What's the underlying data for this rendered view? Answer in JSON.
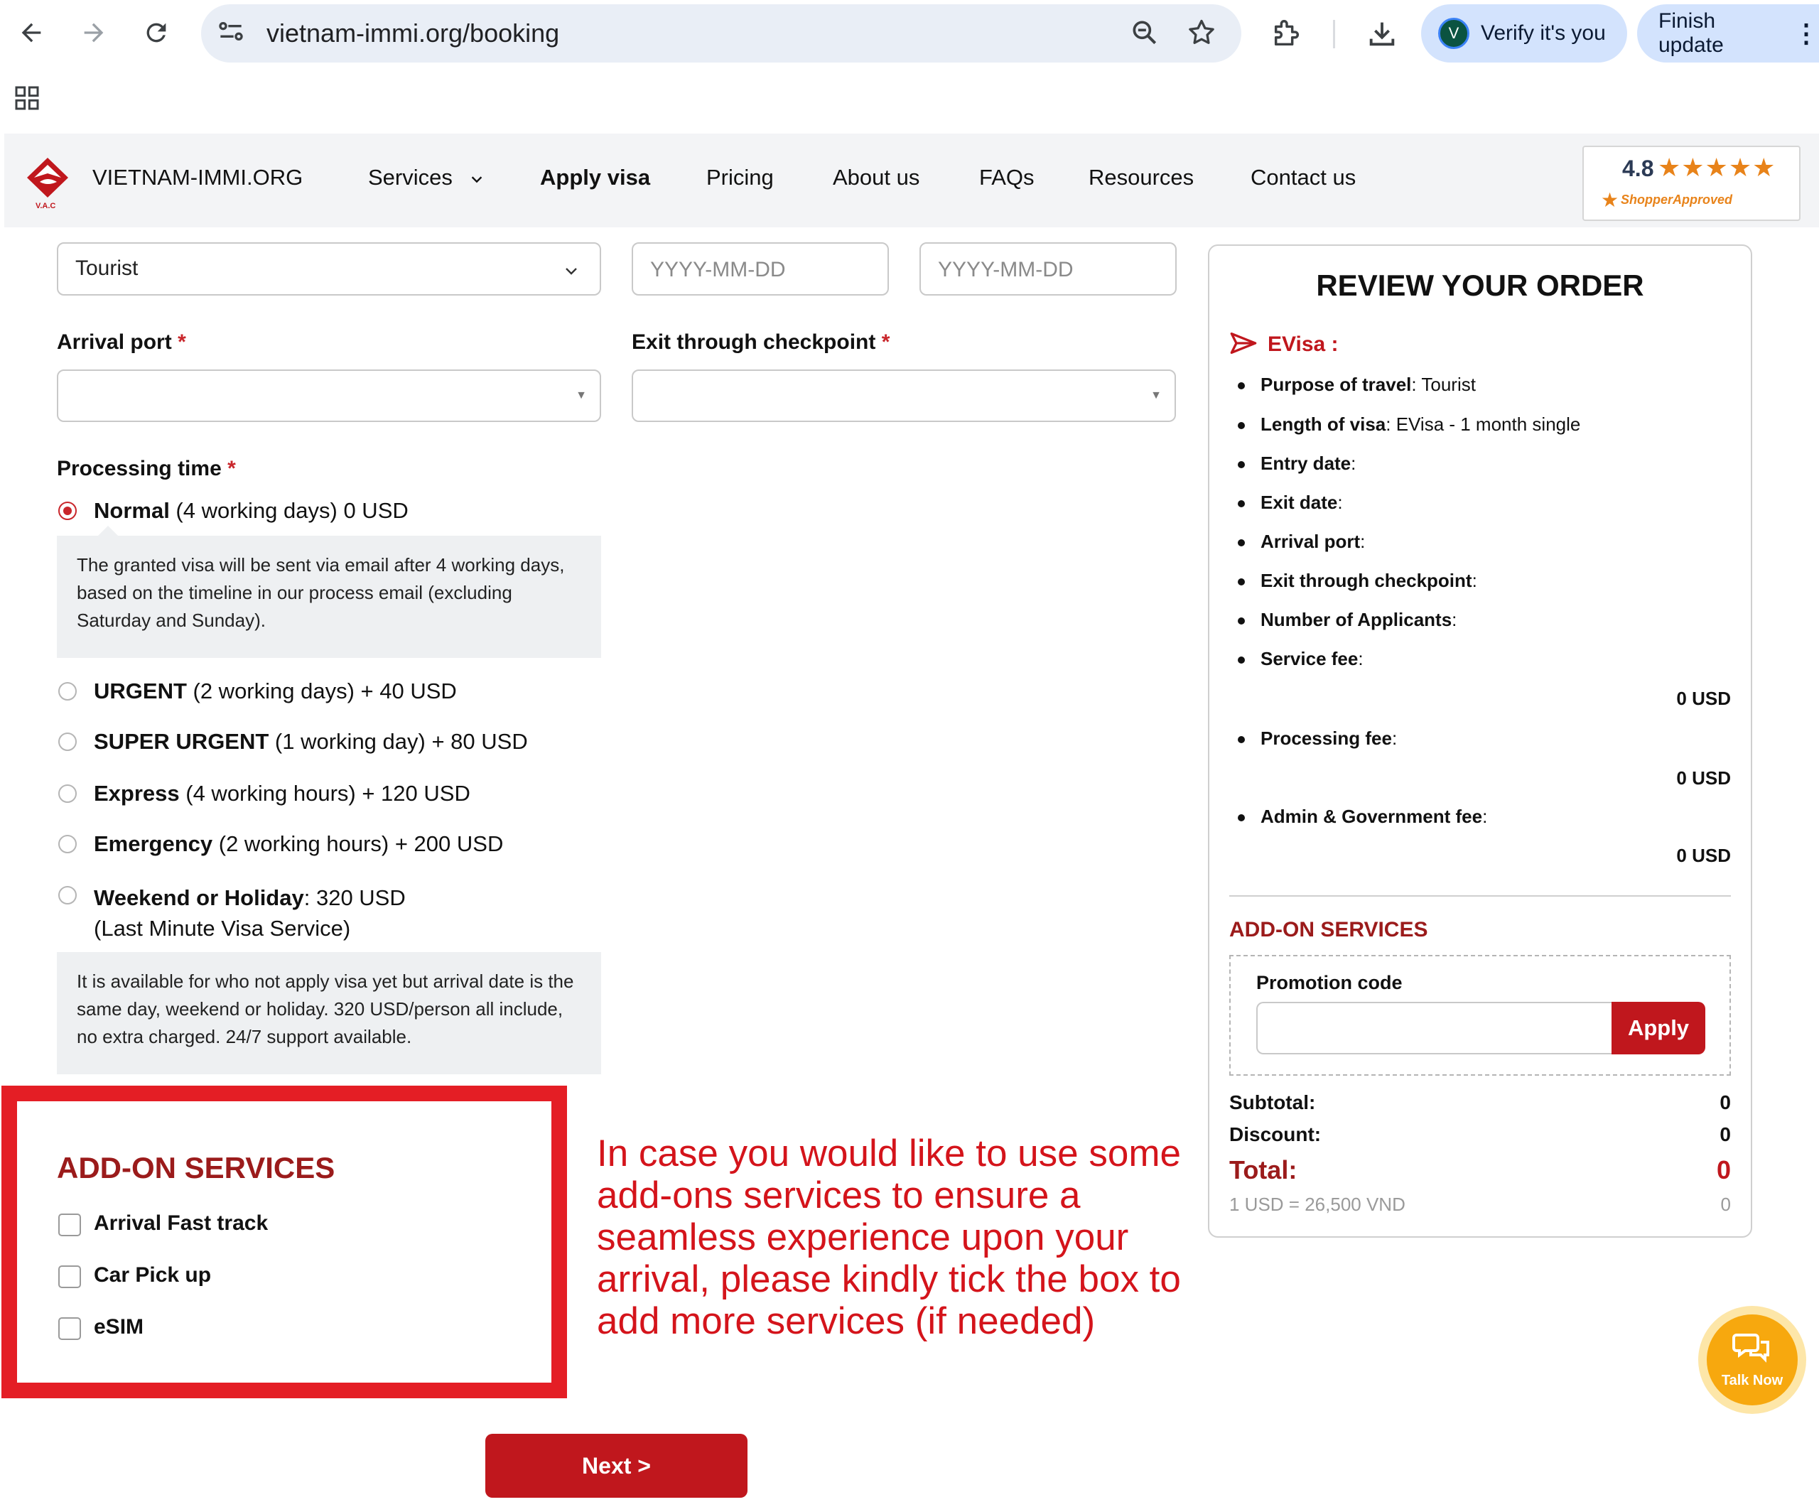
{
  "browser": {
    "url": "vietnam-immi.org/booking",
    "profile_initial": "V",
    "verify_label": "Verify it's you",
    "update_label": "Finish update"
  },
  "header": {
    "brand": "VIETNAM-IMMI.ORG",
    "logo_sub": "V.A.C",
    "menu": [
      "Services",
      "Apply visa",
      "Pricing",
      "About us",
      "FAQs",
      "Resources",
      "Contact us"
    ],
    "rating": "4.8",
    "rating_stars": "★★★★★",
    "rating_brand": "ShopperApproved"
  },
  "form": {
    "purpose_value": "Tourist",
    "entry_date_placeholder": "YYYY-MM-DD",
    "exit_date_placeholder": "YYYY-MM-DD",
    "arrival_port_label": "Arrival port",
    "exit_checkpoint_label": "Exit through checkpoint",
    "required_mark": "*",
    "processing_label": "Processing time",
    "options": [
      {
        "name": "Normal",
        "detail": " (4 working days) 0 USD",
        "checked": true
      },
      {
        "name": "URGENT",
        "detail": " (2 working days) + 40 USD",
        "checked": false
      },
      {
        "name": "SUPER URGENT",
        "detail": " (1 working day) + 80 USD",
        "checked": false
      },
      {
        "name": "Express",
        "detail": " (4 working hours) + 120 USD",
        "checked": false
      },
      {
        "name": "Emergency",
        "detail": " (2 working hours) + 200 USD",
        "checked": false
      },
      {
        "name": "Weekend or Holiday",
        "detail": ": 320 USD",
        "detail2": "(Last Minute Visa Service)",
        "checked": false
      }
    ],
    "normal_note": "The granted visa will be sent via email after 4 working days, based on the timeline in our process email (excluding Saturday and Sunday).",
    "weekend_note": "It is available for who not apply visa yet but arrival date is the same day, weekend or holiday. 320 USD/person all include, no extra charged. 24/7 support available."
  },
  "addons": {
    "title": "ADD-ON SERVICES",
    "items": [
      "Arrival Fast track",
      "Car Pick up",
      "eSIM"
    ]
  },
  "annotation": "In case you would like to use some add-ons services to ensure a seamless experience upon your arrival, please kindly tick the box to add more services (if needed)",
  "next_label": "Next >",
  "review": {
    "title": "REVIEW YOUR ORDER",
    "evisa_label": "EVisa :",
    "rows": [
      {
        "key": "Purpose of travel",
        "value": ": Tourist"
      },
      {
        "key": "Length of visa",
        "value": ": EVisa - 1 month single"
      },
      {
        "key": "Entry date",
        "value": ":"
      },
      {
        "key": "Exit date",
        "value": ":"
      },
      {
        "key": "Arrival port",
        "value": ":"
      },
      {
        "key": "Exit through checkpoint",
        "value": ":"
      },
      {
        "key": "Number of Applicants",
        "value": ":"
      },
      {
        "key": "Service fee",
        "value": ":"
      },
      {
        "key": "Processing fee",
        "value": ":"
      },
      {
        "key": "Admin & Government fee",
        "value": ":"
      }
    ],
    "service_fee": "0 USD",
    "processing_fee": "0 USD",
    "admin_fee": "0 USD",
    "addon_title": "ADD-ON SERVICES",
    "promo_label": "Promotion code",
    "apply_label": "Apply",
    "subtotal_label": "Subtotal:",
    "subtotal_value": "0",
    "discount_label": "Discount:",
    "discount_value": "0",
    "total_label": "Total:",
    "total_value": "0",
    "rate_label": "1 USD = 26,500 VND",
    "rate_value": "0"
  },
  "chat": {
    "label": "Talk Now"
  },
  "colors": {
    "brand_red": "#c0171d",
    "dark_red": "#9b1b1b",
    "annotation_red": "#d4141b",
    "chat_orange": "#f7a80e"
  }
}
